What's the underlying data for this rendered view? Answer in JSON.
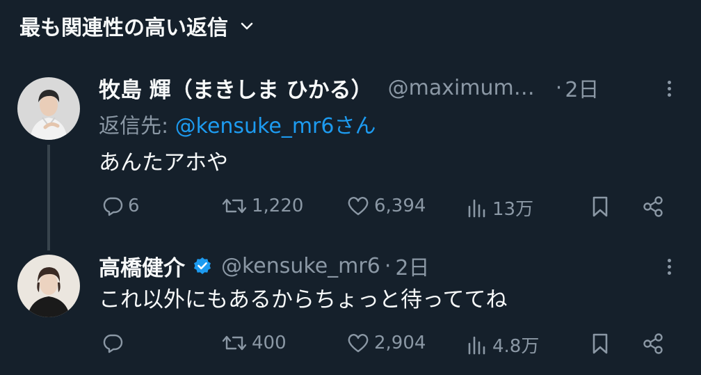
{
  "header": {
    "sort_label": "最も関連性の高い返信"
  },
  "tweets": [
    {
      "display_name": "牧島 輝（まきしま ひかる）",
      "handle": "@maximum…",
      "separator": "·",
      "time": "2日",
      "reply_prefix": "返信先:",
      "reply_mention": "@kensuke_mr6さん",
      "text": "あんたアホや",
      "replies": "6",
      "retweets": "1,220",
      "likes": "6,394",
      "views": "13万"
    },
    {
      "display_name": "高橋健介",
      "handle": "@kensuke_mr6",
      "separator": "·",
      "time": "2日",
      "text": "これ以外にもあるからちょっと待っててね",
      "replies": "",
      "retweets": "400",
      "likes": "2,904",
      "views": "4.8万"
    }
  ],
  "colors": {
    "background": "#15202b",
    "text_primary": "#f7f9f9",
    "text_secondary": "#8b98a5",
    "link": "#1d9bf0",
    "verified": "#1d9bf0"
  },
  "icons": {
    "sort": "chevron-down-icon",
    "reply": "reply-icon",
    "retweet": "retweet-icon",
    "like": "heart-icon",
    "views": "views-chart-icon",
    "bookmark": "bookmark-icon",
    "share": "share-icon",
    "more": "more-icon",
    "verified": "verified-badge-icon"
  }
}
